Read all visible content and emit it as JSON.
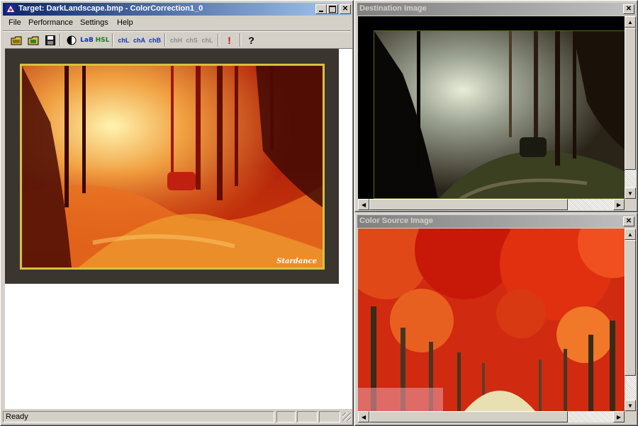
{
  "main_window": {
    "title": "Target: DarkLandscape.bmp - ColorCorrection1_0",
    "menu": [
      "File",
      "Performance",
      "Settings",
      "Help"
    ],
    "toolbar": {
      "lab_label": "LaB",
      "hsl_label": "HSL",
      "ch_l_label": "chL",
      "ch_a_label": "chA",
      "ch_b_label": "chB",
      "ch_h_label": "chH",
      "ch_s_label": "chS",
      "ch_l2_label": "chL",
      "alert_label": "!",
      "help_label": "?"
    },
    "watermark": "Stardance",
    "status_text": "Ready"
  },
  "destination_window": {
    "title": "Destination Image"
  },
  "source_window": {
    "title": "Color Source Image"
  },
  "colors": {
    "active_title": "#0a246a",
    "inactive_title": "#808080",
    "face": "#d4d0c8",
    "image_frame": "#d8c040"
  }
}
